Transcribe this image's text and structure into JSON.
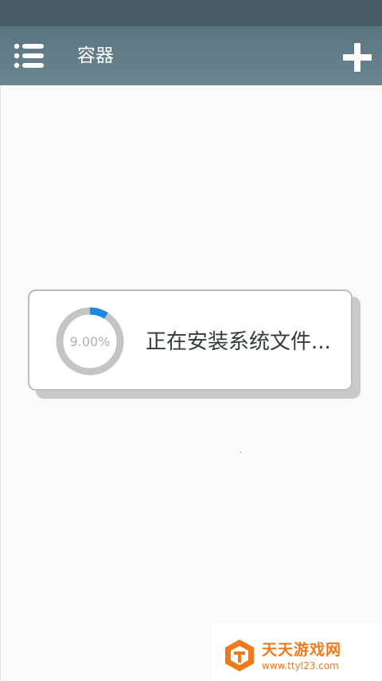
{
  "app": {
    "title": "容器",
    "menu_icon": "list-menu-icon",
    "add_icon": "plus-icon"
  },
  "dialog": {
    "progress_label": "9.00%",
    "progress_fraction": 0.09,
    "message": "正在安装系统文件..."
  },
  "watermark": {
    "title": "天天游戏网",
    "url": "www.ttyl23.com"
  },
  "colors": {
    "status_bar": "#485a64",
    "app_bar": "#607d8b",
    "progress_accent": "#1e88e5",
    "progress_track": "#c4c4c4",
    "watermark": "#f07a1a"
  }
}
